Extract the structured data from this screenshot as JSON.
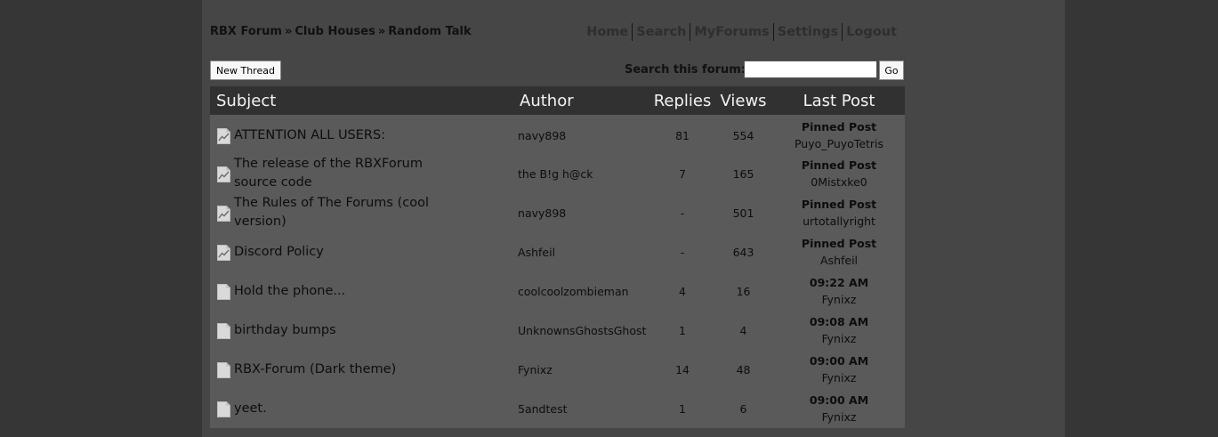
{
  "breadcrumb": {
    "items": [
      "RBX Forum",
      "Club Houses",
      "Random Talk"
    ],
    "separator": "»"
  },
  "nav": {
    "items": [
      "Home",
      "Search",
      "MyForums",
      "Settings",
      "Logout"
    ]
  },
  "toolbar": {
    "new_thread_label": "New Thread",
    "search_label": "Search this forum:",
    "search_value": "",
    "go_label": "Go"
  },
  "table": {
    "headers": {
      "subject": "Subject",
      "author": "Author",
      "replies": "Replies",
      "views": "Views",
      "last_post": "Last Post"
    },
    "rows": [
      {
        "icon": "pinned-thread-icon",
        "subject": "ATTENTION ALL USERS:",
        "author": "navy898",
        "replies": "81",
        "views": "554",
        "last_post_title": "Pinned Post",
        "last_post_user": "Puyo_PuyoTetris"
      },
      {
        "icon": "pinned-thread-icon",
        "subject": "The release of the RBXForum source code",
        "author": "the B!g h@ck",
        "replies": "7",
        "views": "165",
        "last_post_title": "Pinned Post",
        "last_post_user": "0Mistxke0"
      },
      {
        "icon": "pinned-thread-icon",
        "subject": "The Rules of The Forums (cool version)",
        "author": "navy898",
        "replies": "-",
        "views": "501",
        "last_post_title": "Pinned Post",
        "last_post_user": "urtotallyright"
      },
      {
        "icon": "pinned-thread-icon",
        "subject": "Discord Policy",
        "author": "Ashfeil",
        "replies": "-",
        "views": "643",
        "last_post_title": "Pinned Post",
        "last_post_user": "Ashfeil"
      },
      {
        "icon": "thread-icon",
        "subject": "Hold the phone...",
        "author": "coolcoolzombieman",
        "replies": "4",
        "views": "16",
        "last_post_title": "09:22 AM",
        "last_post_user": "Fynixz"
      },
      {
        "icon": "thread-icon",
        "subject": "birthday bumps",
        "author": "UnknownsGhostsGhost",
        "replies": "1",
        "views": "4",
        "last_post_title": "09:08 AM",
        "last_post_user": "Fynixz"
      },
      {
        "icon": "thread-icon",
        "subject": "RBX-Forum (Dark theme)",
        "author": "Fynixz",
        "replies": "14",
        "views": "48",
        "last_post_title": "09:00 AM",
        "last_post_user": "Fynixz"
      },
      {
        "icon": "thread-icon",
        "subject": "yeet.",
        "author": "5andtest",
        "replies": "1",
        "views": "6",
        "last_post_title": "09:00 AM",
        "last_post_user": "Fynixz"
      }
    ]
  },
  "colors": {
    "background": "#363636",
    "panel": "#464646",
    "header_bar": "#313131",
    "row": "#5a5a5a",
    "text": "#0d0d0d"
  }
}
